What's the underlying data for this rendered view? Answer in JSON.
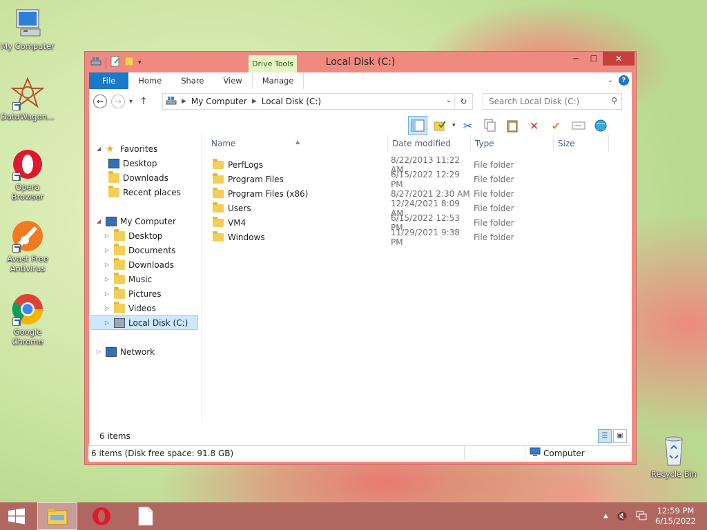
{
  "desktop": {
    "icons": [
      {
        "label": "My Computer"
      },
      {
        "label": "DataWagon..."
      },
      {
        "label": "Opera Browser"
      },
      {
        "label": "Avast Free Antivirus"
      },
      {
        "label": "Google Chrome"
      },
      {
        "label": "Recycle Bin"
      }
    ]
  },
  "window": {
    "title": "Local Disk (C:)",
    "context_tab": "Drive Tools",
    "tabs": [
      "File",
      "Home",
      "Share",
      "View",
      "Manage"
    ],
    "address": {
      "crumbs": [
        "My Computer",
        "Local Disk (C:)"
      ]
    },
    "search_placeholder": "Search Local Disk (C:)"
  },
  "nav_pane": {
    "favorites": {
      "label": "Favorites",
      "items": [
        "Desktop",
        "Downloads",
        "Recent places"
      ]
    },
    "computer": {
      "label": "My Computer",
      "items": [
        "Desktop",
        "Documents",
        "Downloads",
        "Music",
        "Pictures",
        "Videos",
        "Local Disk (C:)"
      ]
    },
    "network": {
      "label": "Network"
    }
  },
  "columns": {
    "name": "Name",
    "date": "Date modified",
    "type": "Type",
    "size": "Size"
  },
  "files": [
    {
      "name": "PerfLogs",
      "date": "8/22/2013 11:22 AM",
      "type": "File folder"
    },
    {
      "name": "Program Files",
      "date": "6/15/2022 12:29 PM",
      "type": "File folder"
    },
    {
      "name": "Program Files (x86)",
      "date": "8/27/2021 2:30 AM",
      "type": "File folder"
    },
    {
      "name": "Users",
      "date": "12/24/2021 8:09 AM",
      "type": "File folder"
    },
    {
      "name": "VM4",
      "date": "6/15/2022 12:53 PM",
      "type": "File folder"
    },
    {
      "name": "Windows",
      "date": "11/29/2021 9:38 PM",
      "type": "File folder"
    }
  ],
  "item_count": "6 items",
  "status": {
    "left": "6 items (Disk free space: 91.8 GB)",
    "right": "Computer"
  },
  "taskbar": {
    "time": "12:59 PM",
    "date": "6/15/2022"
  },
  "colors": {
    "window_frame": "#f08a80",
    "file_tab": "#1979ca",
    "taskbar": "#b06760"
  }
}
